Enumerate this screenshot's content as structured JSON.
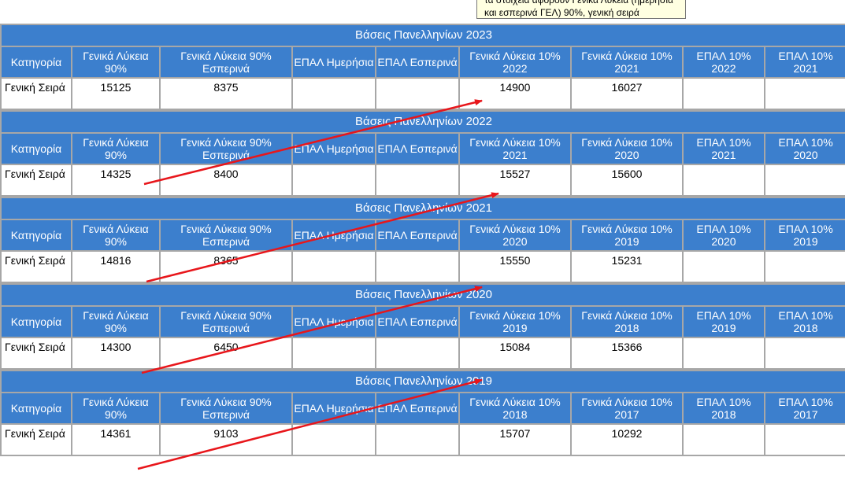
{
  "tooltip": {
    "line1": "τα στοιχεία αφορούν Γενικά Λύκεια (ημερήσια",
    "line2": "και εσπερινά ΓΕΛ) 90%, γενική σειρά"
  },
  "blocks": [
    {
      "title": "Βάσεις Πανελληνίων 2023",
      "headers": [
        "Κατηγορία",
        "Γενικά Λύκεια 90%",
        "Γενικά Λύκεια 90% Εσπερινά",
        "ΕΠΑΛ Ημερήσια",
        "ΕΠΑΛ Εσπερινά",
        "Γενικά Λύκεια 10% 2022",
        "Γενικά Λύκεια 10% 2021",
        "ΕΠΑΛ 10% 2022",
        "ΕΠΑΛ 10% 2021"
      ],
      "row": [
        "Γενική Σειρά",
        "15125",
        "8375",
        "",
        "",
        "14900",
        "16027",
        "",
        ""
      ]
    },
    {
      "title": "Βάσεις Πανελληνίων 2022",
      "headers": [
        "Κατηγορία",
        "Γενικά Λύκεια 90%",
        "Γενικά Λύκεια 90% Εσπερινά",
        "ΕΠΑΛ Ημερήσια",
        "ΕΠΑΛ Εσπερινά",
        "Γενικά Λύκεια 10% 2021",
        "Γενικά Λύκεια 10% 2020",
        "ΕΠΑΛ 10% 2021",
        "ΕΠΑΛ 10% 2020"
      ],
      "row": [
        "Γενική Σειρά",
        "14325",
        "8400",
        "",
        "",
        "15527",
        "15600",
        "",
        ""
      ]
    },
    {
      "title": "Βάσεις Πανελληνίων 2021",
      "headers": [
        "Κατηγορία",
        "Γενικά Λύκεια 90%",
        "Γενικά Λύκεια 90% Εσπερινά",
        "ΕΠΑΛ Ημερήσια",
        "ΕΠΑΛ Εσπερινά",
        "Γενικά Λύκεια 10% 2020",
        "Γενικά Λύκεια 10% 2019",
        "ΕΠΑΛ 10% 2020",
        "ΕΠΑΛ 10% 2019"
      ],
      "row": [
        "Γενική Σειρά",
        "14816",
        "8365",
        "",
        "",
        "15550",
        "15231",
        "",
        ""
      ]
    },
    {
      "title": "Βάσεις Πανελληνίων 2020",
      "headers": [
        "Κατηγορία",
        "Γενικά Λύκεια 90%",
        "Γενικά Λύκεια 90% Εσπερινά",
        "ΕΠΑΛ Ημερήσια",
        "ΕΠΑΛ Εσπερινά",
        "Γενικά Λύκεια 10% 2019",
        "Γενικά Λύκεια 10% 2018",
        "ΕΠΑΛ 10% 2019",
        "ΕΠΑΛ 10% 2018"
      ],
      "row": [
        "Γενική Σειρά",
        "14300",
        "6450",
        "",
        "",
        "15084",
        "15366",
        "",
        ""
      ]
    },
    {
      "title": "Βάσεις Πανελληνίων 2019",
      "headers": [
        "Κατηγορία",
        "Γενικά Λύκεια 90%",
        "Γενικά Λύκεια 90% Εσπερινά",
        "ΕΠΑΛ Ημερήσια",
        "ΕΠΑΛ Εσπερινά",
        "Γενικά Λύκεια 10% 2018",
        "Γενικά Λύκεια 10% 2017",
        "ΕΠΑΛ 10% 2018",
        "ΕΠΑΛ 10% 2017"
      ],
      "row": [
        "Γενική Σειρά",
        "14361",
        "9103",
        "",
        "",
        "15707",
        "10292",
        "",
        ""
      ]
    }
  ],
  "arrow_color": "#e8161b"
}
